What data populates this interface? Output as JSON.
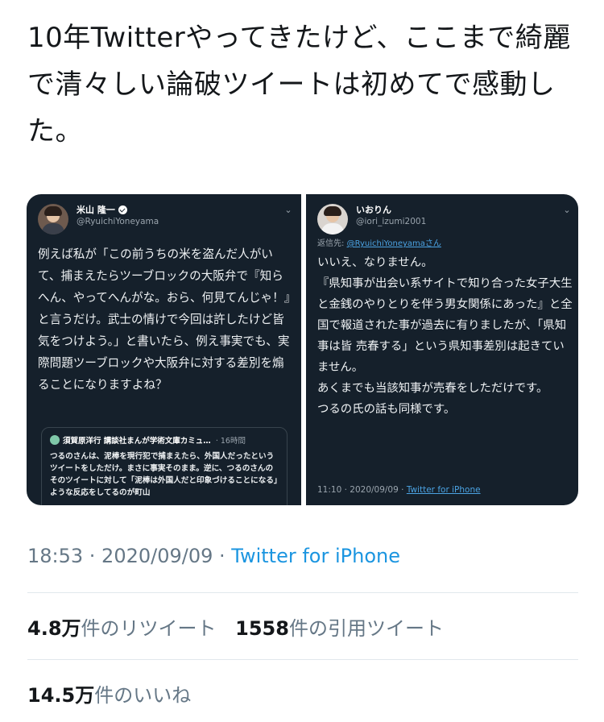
{
  "tweet": {
    "text": "10年Twitterやってきたけど、ここまで綺麗で清々しい論破ツイートは初めてで感動した。"
  },
  "left_shot": {
    "name": "米山 隆一",
    "handle": "@RyuichiYoneyama",
    "body": "例えば私が「この前うちの米を盗んだ人がいて、捕まえたらツーブロックの大阪弁で『知らへん、やってへんがな。おら、何見てんじゃ！』と言うだけ。武士の情けで今回は許したけど皆気をつけよう。」と書いたら、例え事実でも、実際問題ツーブロックや大阪弁に対する差別を煽ることになりますよね？",
    "quote": {
      "name": "須賀原洋行 講談社まんが学術文庫カミュ…",
      "time": "· 16時間",
      "body": "つるのさんは、泥棒を現行犯で捕まえたら、外国人だったというツイートをしただけ。まさに事実そのまま。逆に、つるのさんのそのツイートに対して「泥棒は外国人だと印象づけることになる」ような反応をしてるのが町山"
    }
  },
  "right_shot": {
    "name": "いおりん",
    "handle": "@iori_izumi2001",
    "replying_prefix": "返信先: ",
    "replying_mention": "@RyuichiYoneyamaさん",
    "body_lines": [
      "いいえ、なりません。",
      "『県知事が出会い系サイトで知り合った女子大生と金銭のやりとりを伴う男女関係にあった』と全国で報道された事が過去に有りましたが、「県知事は皆 売春する」という県知事差別は起きていません。",
      "あくまでも当該知事が売春をしただけです。",
      "つるの氏の話も同様です。"
    ],
    "timestamp": "11:10 · 2020/09/09 · ",
    "source": "Twitter for iPhone"
  },
  "meta": {
    "time": "18:53 · 2020/09/09 · ",
    "client": "Twitter for iPhone"
  },
  "stats": {
    "retweets_num": "4.8万",
    "retweets_label": "件のリツイート",
    "quotes_num": "1558",
    "quotes_label": "件の引用ツイート",
    "likes_num": "14.5万",
    "likes_label": "件のいいね"
  },
  "colors": {
    "link": "#1b95e0",
    "dark_bg": "#15202b",
    "muted": "#657786"
  },
  "icons": [
    "verified-badge-icon",
    "chevron-down-icon"
  ]
}
